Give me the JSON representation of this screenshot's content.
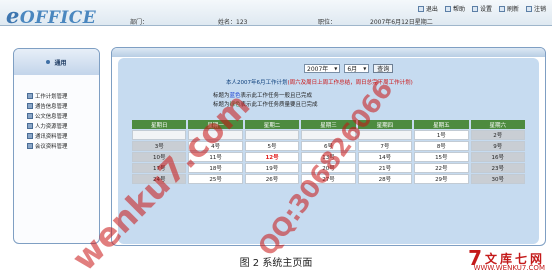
{
  "header": {
    "logo_prefix": "e",
    "logo_main": "OFFICE",
    "dept_label": "部门：",
    "name_label": "姓名：123",
    "position_label": "职位：",
    "date_text": "2007年6月12日星期二",
    "toolbar": [
      "退出",
      "帮助",
      "设置",
      "刷新",
      "注销"
    ]
  },
  "left_panel": {
    "title": "通用",
    "items": [
      "工作计划管理",
      "通告信息管理",
      "公文信息管理",
      "人力资源管理",
      "通讯资料管理",
      "会议资料管理"
    ]
  },
  "main": {
    "year_value": "2007年",
    "month_value": "6月",
    "query_label": "查询",
    "info_prefix": "本人2007年6月工作计划",
    "info_red": "(周六及周日上周工作总结，周日总完下周工作计划)",
    "legend_line1_prefix": "标题为",
    "legend_line1_blue": "蓝色",
    "legend_line1_suffix": "表示此工作任务一般且已完成",
    "legend_line2_prefix": "标题为",
    "legend_line2_green": "绿色",
    "legend_line2_suffix": "表示此工作任务质量要且已完成"
  },
  "calendar": {
    "headers": [
      "星期日",
      "星期一",
      "星期二",
      "星期三",
      "星期四",
      "星期五",
      "星期六"
    ],
    "rows": [
      [
        "",
        "",
        "",
        "",
        "",
        "1号",
        "2号"
      ],
      [
        "3号",
        "4号",
        "5号",
        "6号",
        "7号",
        "8号",
        "9号"
      ],
      [
        "10号",
        "11号",
        "12号",
        "13号",
        "14号",
        "15号",
        "16号"
      ],
      [
        "17号",
        "18号",
        "19号",
        "20号",
        "21号",
        "22号",
        "23号"
      ],
      [
        "24号",
        "25号",
        "26号",
        "27号",
        "28号",
        "29号",
        "30号"
      ]
    ],
    "today": "12号"
  },
  "caption": "图 2 系统主页面",
  "watermark": {
    "logo_mark": "7",
    "logo_name": "文库七网",
    "logo_url": "WWW.WENKU7.COM",
    "stamp1": "wenku7.com",
    "stamp2": "QQ:306826066"
  }
}
